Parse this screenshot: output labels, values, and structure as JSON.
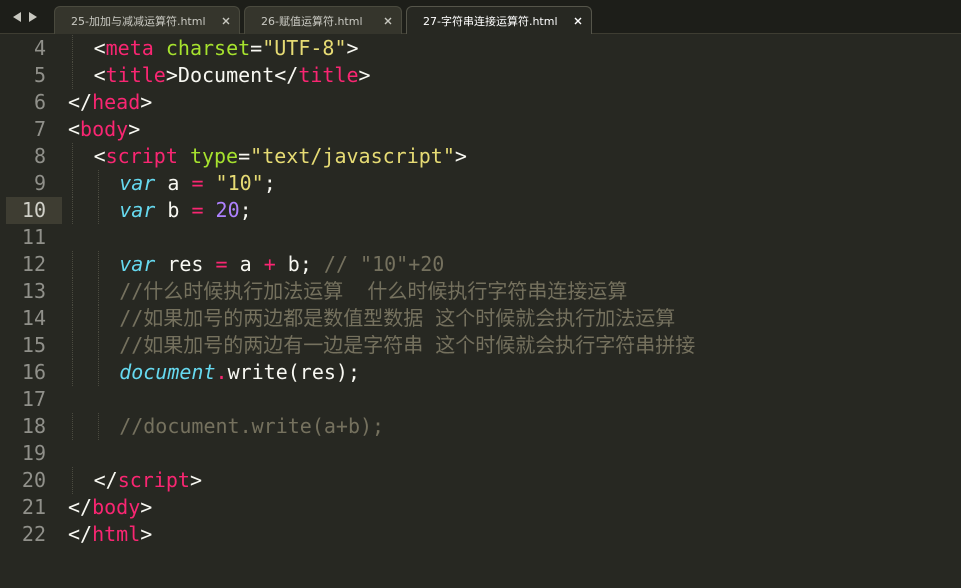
{
  "tabs": [
    {
      "label": "25-加加与减减运算符.html",
      "active": false
    },
    {
      "label": "26-赋值运算符.html",
      "active": false
    },
    {
      "label": "27-字符串连接运算符.html",
      "active": true
    }
  ],
  "icons": {
    "nav_left": "triangle-left-icon",
    "nav_right": "triangle-right-icon",
    "tab_close": "close-icon"
  },
  "colors": {
    "background": "#272822",
    "tag": "#f92672",
    "attribute": "#a6e22e",
    "string": "#e6db74",
    "keyword": "#66d9ef",
    "number": "#ae81ff",
    "comment": "#75715e"
  },
  "editor": {
    "current_line": "10",
    "lines": [
      {
        "no": "4",
        "indent": 2,
        "tokens": [
          {
            "t": "<",
            "c": "plain"
          },
          {
            "t": "meta",
            "c": "tag"
          },
          {
            "t": " ",
            "c": "plain"
          },
          {
            "t": "charset",
            "c": "attr"
          },
          {
            "t": "=",
            "c": "plain"
          },
          {
            "t": "\"UTF-8\"",
            "c": "str"
          },
          {
            "t": ">",
            "c": "plain"
          }
        ]
      },
      {
        "no": "5",
        "indent": 2,
        "tokens": [
          {
            "t": "<",
            "c": "plain"
          },
          {
            "t": "title",
            "c": "tag"
          },
          {
            "t": ">Document</",
            "c": "plain"
          },
          {
            "t": "title",
            "c": "tag"
          },
          {
            "t": ">",
            "c": "plain"
          }
        ]
      },
      {
        "no": "6",
        "indent": 0,
        "tokens": [
          {
            "t": "</",
            "c": "plain"
          },
          {
            "t": "head",
            "c": "tag"
          },
          {
            "t": ">",
            "c": "plain"
          }
        ]
      },
      {
        "no": "7",
        "indent": 0,
        "tokens": [
          {
            "t": "<",
            "c": "plain"
          },
          {
            "t": "body",
            "c": "tag"
          },
          {
            "t": ">",
            "c": "plain"
          }
        ]
      },
      {
        "no": "8",
        "indent": 2,
        "tokens": [
          {
            "t": "<",
            "c": "plain"
          },
          {
            "t": "script",
            "c": "tag"
          },
          {
            "t": " ",
            "c": "plain"
          },
          {
            "t": "type",
            "c": "attr"
          },
          {
            "t": "=",
            "c": "plain"
          },
          {
            "t": "\"text/javascript\"",
            "c": "str"
          },
          {
            "t": ">",
            "c": "plain"
          }
        ]
      },
      {
        "no": "9",
        "indent": 4,
        "tokens": [
          {
            "t": "var",
            "c": "kw"
          },
          {
            "t": " a ",
            "c": "plain"
          },
          {
            "t": "=",
            "c": "op"
          },
          {
            "t": " ",
            "c": "plain"
          },
          {
            "t": "\"10\"",
            "c": "str"
          },
          {
            "t": ";",
            "c": "plain"
          }
        ]
      },
      {
        "no": "10",
        "indent": 4,
        "tokens": [
          {
            "t": "var",
            "c": "kw"
          },
          {
            "t": " b ",
            "c": "plain"
          },
          {
            "t": "=",
            "c": "op"
          },
          {
            "t": " ",
            "c": "plain"
          },
          {
            "t": "20",
            "c": "num"
          },
          {
            "t": ";",
            "c": "plain"
          }
        ]
      },
      {
        "no": "11",
        "indent": 0,
        "tokens": []
      },
      {
        "no": "12",
        "indent": 4,
        "tokens": [
          {
            "t": "var",
            "c": "kw"
          },
          {
            "t": " res ",
            "c": "plain"
          },
          {
            "t": "=",
            "c": "op"
          },
          {
            "t": " a ",
            "c": "plain"
          },
          {
            "t": "+",
            "c": "op"
          },
          {
            "t": " b; ",
            "c": "plain"
          },
          {
            "t": "// \"10\"+20",
            "c": "com"
          }
        ]
      },
      {
        "no": "13",
        "indent": 4,
        "tokens": [
          {
            "t": "//什么时候执行加法运算  什么时候执行字符串连接运算",
            "c": "com"
          }
        ]
      },
      {
        "no": "14",
        "indent": 4,
        "tokens": [
          {
            "t": "//如果加号的两边都是数值型数据 这个时候就会执行加法运算",
            "c": "com"
          }
        ]
      },
      {
        "no": "15",
        "indent": 4,
        "tokens": [
          {
            "t": "//如果加号的两边有一边是字符串 这个时候就会执行字符串拼接",
            "c": "com"
          }
        ]
      },
      {
        "no": "16",
        "indent": 4,
        "tokens": [
          {
            "t": "document",
            "c": "kw"
          },
          {
            "t": ".",
            "c": "op"
          },
          {
            "t": "write(res);",
            "c": "plain"
          }
        ]
      },
      {
        "no": "17",
        "indent": 0,
        "tokens": []
      },
      {
        "no": "18",
        "indent": 4,
        "tokens": [
          {
            "t": "//document.write(a+b);",
            "c": "com"
          }
        ]
      },
      {
        "no": "19",
        "indent": 0,
        "tokens": []
      },
      {
        "no": "20",
        "indent": 2,
        "tokens": [
          {
            "t": "</",
            "c": "plain"
          },
          {
            "t": "script",
            "c": "tag"
          },
          {
            "t": ">",
            "c": "plain"
          }
        ]
      },
      {
        "no": "21",
        "indent": 0,
        "tokens": [
          {
            "t": "</",
            "c": "plain"
          },
          {
            "t": "body",
            "c": "tag"
          },
          {
            "t": ">",
            "c": "plain"
          }
        ]
      },
      {
        "no": "22",
        "indent": 0,
        "tokens": [
          {
            "t": "</",
            "c": "plain"
          },
          {
            "t": "html",
            "c": "tag"
          },
          {
            "t": ">",
            "c": "plain"
          }
        ]
      }
    ]
  }
}
